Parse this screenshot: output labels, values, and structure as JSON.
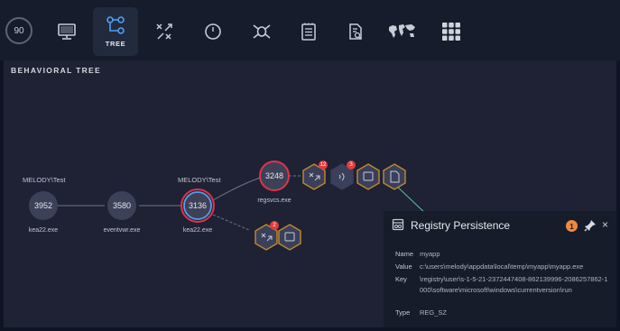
{
  "toolbar": {
    "score": "90",
    "buttons": [
      {
        "icon": "monitor-icon",
        "label": ""
      },
      {
        "icon": "tree-icon",
        "label": "TREE",
        "active": true
      },
      {
        "icon": "process-cross-icon",
        "label": ""
      },
      {
        "icon": "timer-circle-icon",
        "label": ""
      },
      {
        "icon": "bug-icon",
        "label": ""
      },
      {
        "icon": "document-list-icon",
        "label": ""
      },
      {
        "icon": "file-search-icon",
        "label": ""
      },
      {
        "icon": "world-map-icon",
        "label": ""
      },
      {
        "icon": "grid-apps-icon",
        "label": ""
      }
    ]
  },
  "tree": {
    "title": "BEHAVIORAL TREE",
    "nodes": [
      {
        "pid": "3952",
        "name": "kea22.exe",
        "user": "MELODY\\Test"
      },
      {
        "pid": "3580",
        "name": "eventvwr.exe",
        "user": ""
      },
      {
        "pid": "3136",
        "name": "kea22.exe",
        "user": "MELODY\\Test"
      },
      {
        "pid": "3248",
        "name": "regsvcs.exe",
        "user": ""
      }
    ],
    "event_badges": [
      "12",
      "3",
      "2"
    ]
  },
  "popup": {
    "title": "Registry Persistence",
    "badge": "1",
    "close": "×",
    "fields": [
      {
        "key": "Name",
        "value": "myapp"
      },
      {
        "key": "Value",
        "value": "c:\\users\\melody\\appdata\\local\\temp\\myapp\\myapp.exe"
      },
      {
        "key": "Key",
        "value": "\\registry\\user\\s-1-5-21-2372447408-862139996-2086257862-1000\\software\\microsoft\\windows\\currentversion\\run"
      },
      {
        "key": "Type",
        "value": "REG_SZ"
      }
    ]
  },
  "colors": {
    "background": "#0f1424",
    "toolbar": "#161c2c",
    "panel": "#1e2234",
    "alert_red": "#e0334a",
    "accent_blue": "#5b9be8",
    "hex_amber": "#c48a2a",
    "hex_fill": "#3a3f5a",
    "badge_red": "#e23c3c",
    "warn_orange": "#ef8a3c",
    "connector_green": "#55c4a2"
  }
}
